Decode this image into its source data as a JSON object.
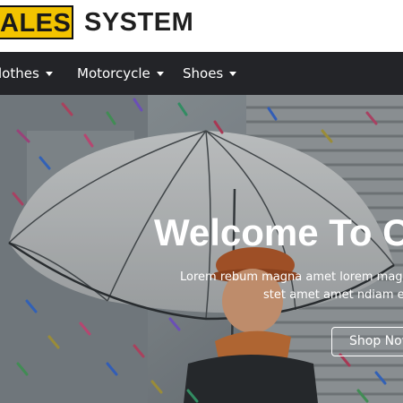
{
  "brand": {
    "accent_text": "ALES",
    "main_text": "SYSTEM",
    "accent_color": "#f2c300"
  },
  "nav": {
    "items": [
      {
        "label": "lothes",
        "icon": "caret-down-icon"
      },
      {
        "label": "Motorcycle",
        "icon": "caret-down-icon"
      },
      {
        "label": "Shoes",
        "icon": "caret-down-icon"
      }
    ],
    "background": "#232428"
  },
  "hero": {
    "title": "Welcome To C",
    "subtitle_line1": "Lorem rebum magna amet lorem mag",
    "subtitle_line2": "stet amet amet ndiam e",
    "cta_label": "Shop Now"
  }
}
